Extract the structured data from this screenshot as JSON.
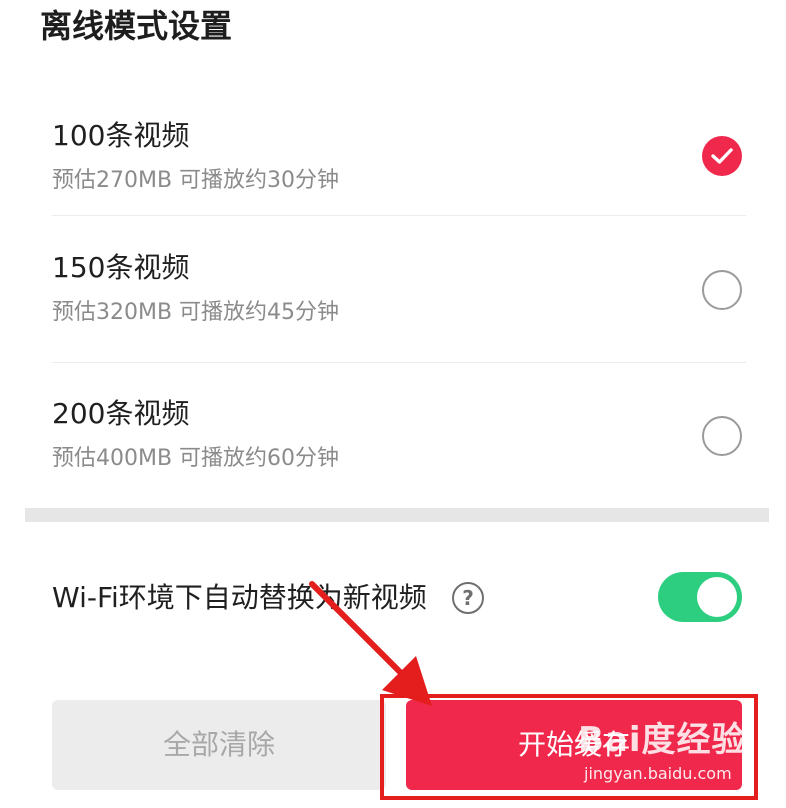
{
  "page_title": "离线模式设置",
  "options": [
    {
      "title": "100条视频",
      "subtitle": "预估270MB 可播放约30分钟",
      "selected": true
    },
    {
      "title": "150条视频",
      "subtitle": "预估320MB 可播放约45分钟",
      "selected": false
    },
    {
      "title": "200条视频",
      "subtitle": "预估400MB 可播放约60分钟",
      "selected": false
    }
  ],
  "wifi_setting": {
    "label": "Wi-Fi环境下自动替换为新视频",
    "help_icon": "question-circle-icon",
    "help_glyph": "?",
    "enabled": true
  },
  "buttons": {
    "clear_label": "全部清除",
    "cache_label": "开始缓存"
  },
  "watermark": {
    "logo": "Bai度经验",
    "url": "jingyan.baidu.com"
  },
  "colors": {
    "accent": "#f0294c",
    "toggle_on": "#2dce7f",
    "annotation": "#e41d1d"
  }
}
